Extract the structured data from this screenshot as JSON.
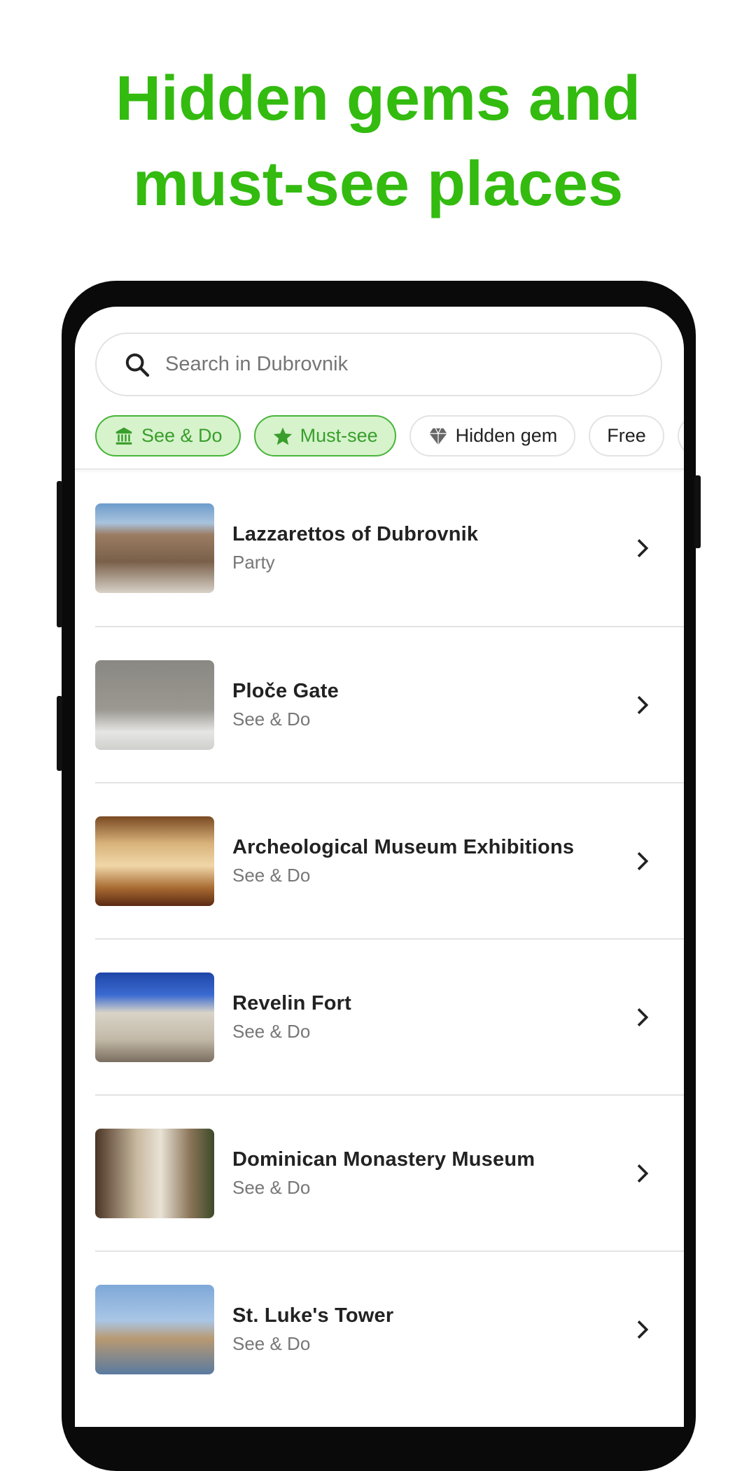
{
  "headline": {
    "line1": "Hidden gems and",
    "line2": "must-see places"
  },
  "search": {
    "placeholder": "Search in Dubrovnik",
    "icon": "search-icon"
  },
  "chips": [
    {
      "label": "See & Do",
      "icon": "museum-icon",
      "active": true
    },
    {
      "label": "Must-see",
      "icon": "star-icon",
      "active": true
    },
    {
      "label": "Hidden gem",
      "icon": "diamond-icon",
      "active": false
    },
    {
      "label": "Free",
      "active": false
    }
  ],
  "places": [
    {
      "title": "Lazzarettos of Dubrovnik",
      "category": "Party"
    },
    {
      "title": "Ploče Gate",
      "category": "See & Do"
    },
    {
      "title": "Archeological Museum Exhibitions",
      "category": "See & Do"
    },
    {
      "title": "Revelin Fort",
      "category": "See & Do"
    },
    {
      "title": "Dominican Monastery Museum",
      "category": "See & Do"
    },
    {
      "title": "St. Luke's Tower",
      "category": "See & Do"
    }
  ],
  "colors": {
    "accent": "#33bb0f",
    "chip_active_bg": "#d6f3cc",
    "chip_active_border": "#48b43a"
  }
}
